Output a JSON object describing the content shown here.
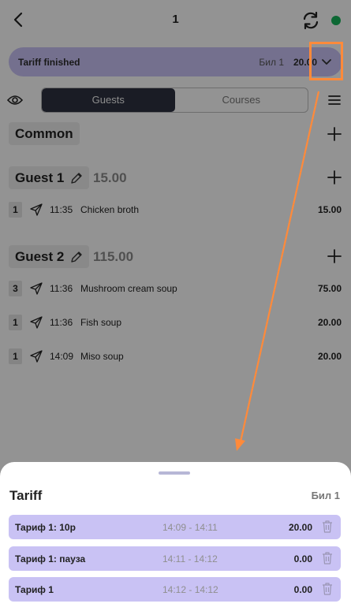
{
  "header": {
    "title": "1",
    "status_color": "#17b45a"
  },
  "tariff_bar": {
    "status": "Tariff finished",
    "bill": "Бил 1",
    "total": "20.00"
  },
  "tabs": [
    {
      "label": "Guests",
      "active": true
    },
    {
      "label": "Courses",
      "active": false
    }
  ],
  "sections": {
    "common": {
      "title": "Common"
    },
    "guest1": {
      "title": "Guest 1",
      "sum": "15.00",
      "orders": [
        {
          "qty": "1",
          "time": "11:35",
          "name": "Chicken broth",
          "price": "15.00"
        }
      ]
    },
    "guest2": {
      "title": "Guest 2",
      "sum": "115.00",
      "orders": [
        {
          "qty": "3",
          "time": "11:36",
          "name": "Mushroom cream soup",
          "price": "75.00"
        },
        {
          "qty": "1",
          "time": "11:36",
          "name": "Fish soup",
          "price": "20.00"
        },
        {
          "qty": "1",
          "time": "14:09",
          "name": "Miso soup",
          "price": "20.00"
        }
      ]
    }
  },
  "sheet": {
    "title": "Tariff",
    "bill": "Бил 1",
    "rows": [
      {
        "name": "Тариф 1: 10р",
        "time": "14:09 - 14:11",
        "amount": "20.00"
      },
      {
        "name": "Тариф 1: пауза",
        "time": "14:11 - 14:12",
        "amount": "0.00"
      },
      {
        "name": "Тариф 1",
        "time": "14:12 - 14:12",
        "amount": "0.00"
      }
    ]
  },
  "colors": {
    "accent": "#c9c2f4",
    "annotation": "#ff8a3a",
    "active_tab": "#2d3140"
  },
  "icons": [
    "back-arrow-icon",
    "refresh-icon",
    "chevron-down-icon",
    "eye-icon",
    "menu-icon",
    "plus-icon",
    "pencil-icon",
    "send-icon",
    "trash-icon"
  ]
}
